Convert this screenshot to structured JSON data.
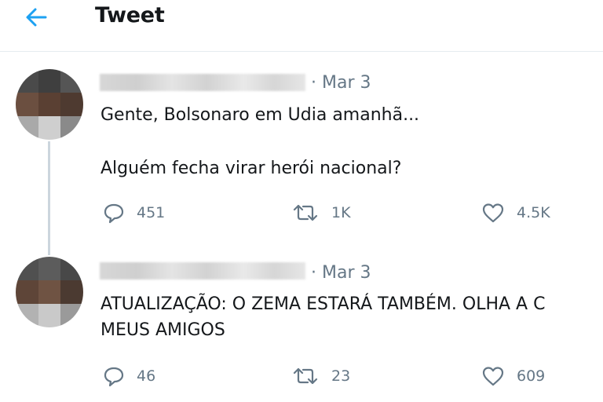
{
  "header": {
    "title": "Tweet",
    "back_icon": "arrow-left-icon"
  },
  "colors": {
    "accent": "#1da1f2",
    "muted": "#657786",
    "text": "#14171a",
    "divider": "#e6ecf0"
  },
  "tweets": [
    {
      "date": "· Mar 3",
      "lines": [
        "Gente, Bolsonaro em Udia amanhã...",
        "Alguém fecha virar herói nacional?"
      ],
      "replies": "451",
      "retweets": "1K",
      "likes": "4.5K"
    },
    {
      "date": "· Mar 3",
      "lines": [
        "ATUALIZAÇÃO: O ZEMA ESTARÁ TAMBÉM. OLHA A C",
        "MEUS AMIGOS"
      ],
      "replies": "46",
      "retweets": "23",
      "likes": "609"
    }
  ]
}
